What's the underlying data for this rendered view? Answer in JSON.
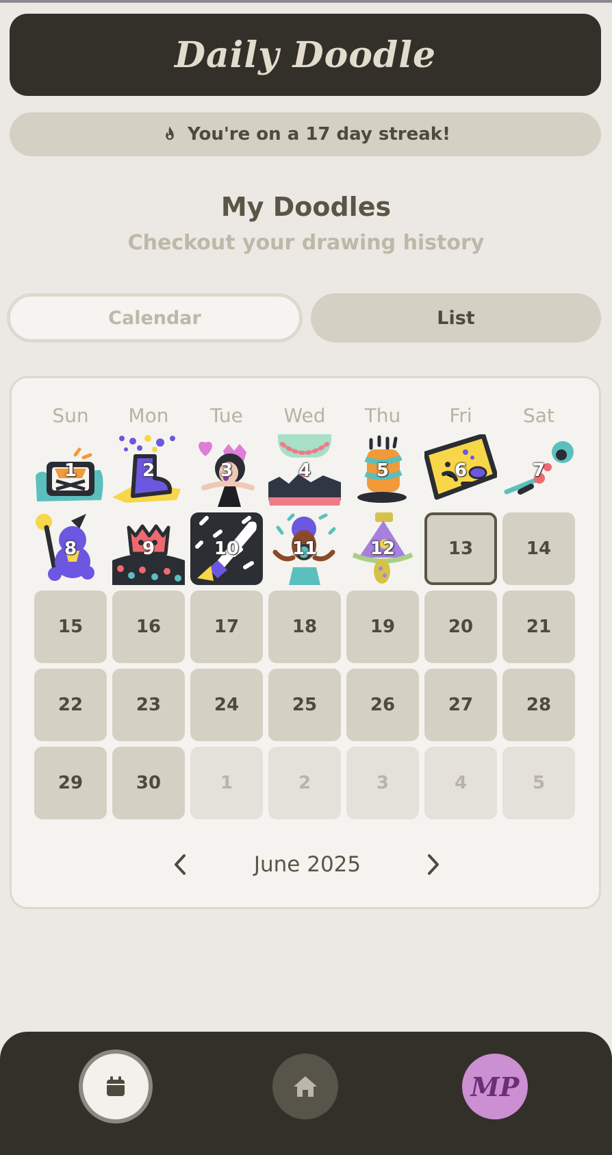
{
  "app": {
    "title": "Daily Doodle"
  },
  "streak": {
    "text": "You're on a 17 day streak!",
    "icon": "flame-icon"
  },
  "section": {
    "title": "My Doodles",
    "subtitle": "Checkout your drawing history"
  },
  "tabs": [
    {
      "label": "Calendar",
      "selected": true
    },
    {
      "label": "List",
      "selected": false
    }
  ],
  "calendar": {
    "weekdays": [
      "Sun",
      "Mon",
      "Tue",
      "Wed",
      "Thu",
      "Fri",
      "Sat"
    ],
    "month_label": "June 2025",
    "days": [
      {
        "label": "1",
        "doodle": "treasure-chest"
      },
      {
        "label": "2",
        "doodle": "purple-boot"
      },
      {
        "label": "3",
        "doodle": "girl-with-heart"
      },
      {
        "label": "4",
        "doodle": "hot-air-landscape"
      },
      {
        "label": "5",
        "doodle": "birthday-cake"
      },
      {
        "label": "6",
        "doodle": "yellow-map"
      },
      {
        "label": "7",
        "doodle": "flower-wand"
      },
      {
        "label": "8",
        "doodle": "purple-bear"
      },
      {
        "label": "9",
        "doodle": "red-cat"
      },
      {
        "label": "10",
        "doodle": "rocket-night"
      },
      {
        "label": "11",
        "doodle": "cheering-person"
      },
      {
        "label": "12",
        "doodle": "party-tree"
      },
      {
        "label": "13",
        "today": true
      },
      {
        "label": "14"
      },
      {
        "label": "15"
      },
      {
        "label": "16"
      },
      {
        "label": "17"
      },
      {
        "label": "18"
      },
      {
        "label": "19"
      },
      {
        "label": "20"
      },
      {
        "label": "21"
      },
      {
        "label": "22"
      },
      {
        "label": "23"
      },
      {
        "label": "24"
      },
      {
        "label": "25"
      },
      {
        "label": "26"
      },
      {
        "label": "27"
      },
      {
        "label": "28"
      },
      {
        "label": "29"
      },
      {
        "label": "30"
      },
      {
        "label": "1",
        "other_month": true
      },
      {
        "label": "2",
        "other_month": true
      },
      {
        "label": "3",
        "other_month": true
      },
      {
        "label": "4",
        "other_month": true
      },
      {
        "label": "5",
        "other_month": true
      }
    ]
  },
  "bottom_nav": {
    "items": [
      {
        "icon": "calendar-icon",
        "active": true
      },
      {
        "icon": "home-icon",
        "active": false
      },
      {
        "initials": "MP"
      }
    ]
  },
  "colors": {
    "background": "#ece9e4",
    "header": "#33302a",
    "pill": "#d4d0c4",
    "avatar": "#cc8fd2"
  }
}
